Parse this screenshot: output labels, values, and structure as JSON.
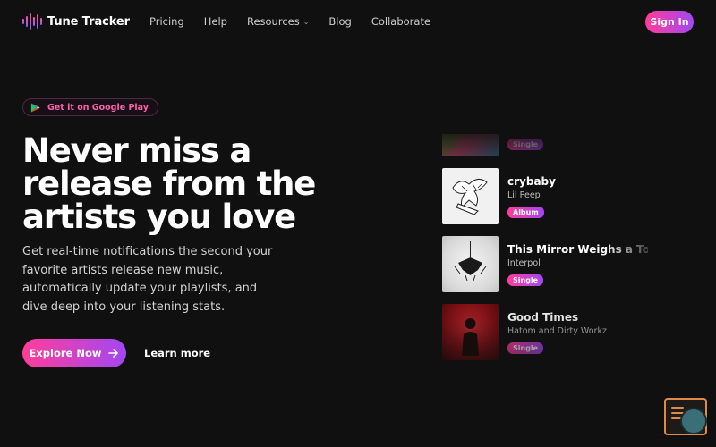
{
  "nav": {
    "brand": "Tune Tracker",
    "links": [
      "Pricing",
      "Help",
      "Resources",
      "Blog",
      "Collaborate"
    ],
    "resources_chevron": "⌄",
    "sign_in": "Sign In"
  },
  "hero": {
    "badge": "Get it on Google Play",
    "headline": "Never miss a release from the artists you love",
    "subtext": "Get real-time notifications the second your favorite artists release new music, automatically update your playlists, and dive deep into your listening stats.",
    "cta_primary": "Explore Now",
    "cta_secondary": "Learn more"
  },
  "releases": [
    {
      "title": "",
      "artist": "",
      "type": "Single"
    },
    {
      "title": "crybaby",
      "artist": "Lil Peep",
      "type": "Album"
    },
    {
      "title": "This Mirror Weighs a Ton",
      "artist": "Interpol",
      "type": "Single"
    },
    {
      "title": "Good Times",
      "artist": "Hatom and Dirty Workz",
      "type": "Single"
    }
  ],
  "colors": {
    "background": "#101010",
    "accent_start": "#ff3d9a",
    "accent_end": "#a347f2"
  }
}
